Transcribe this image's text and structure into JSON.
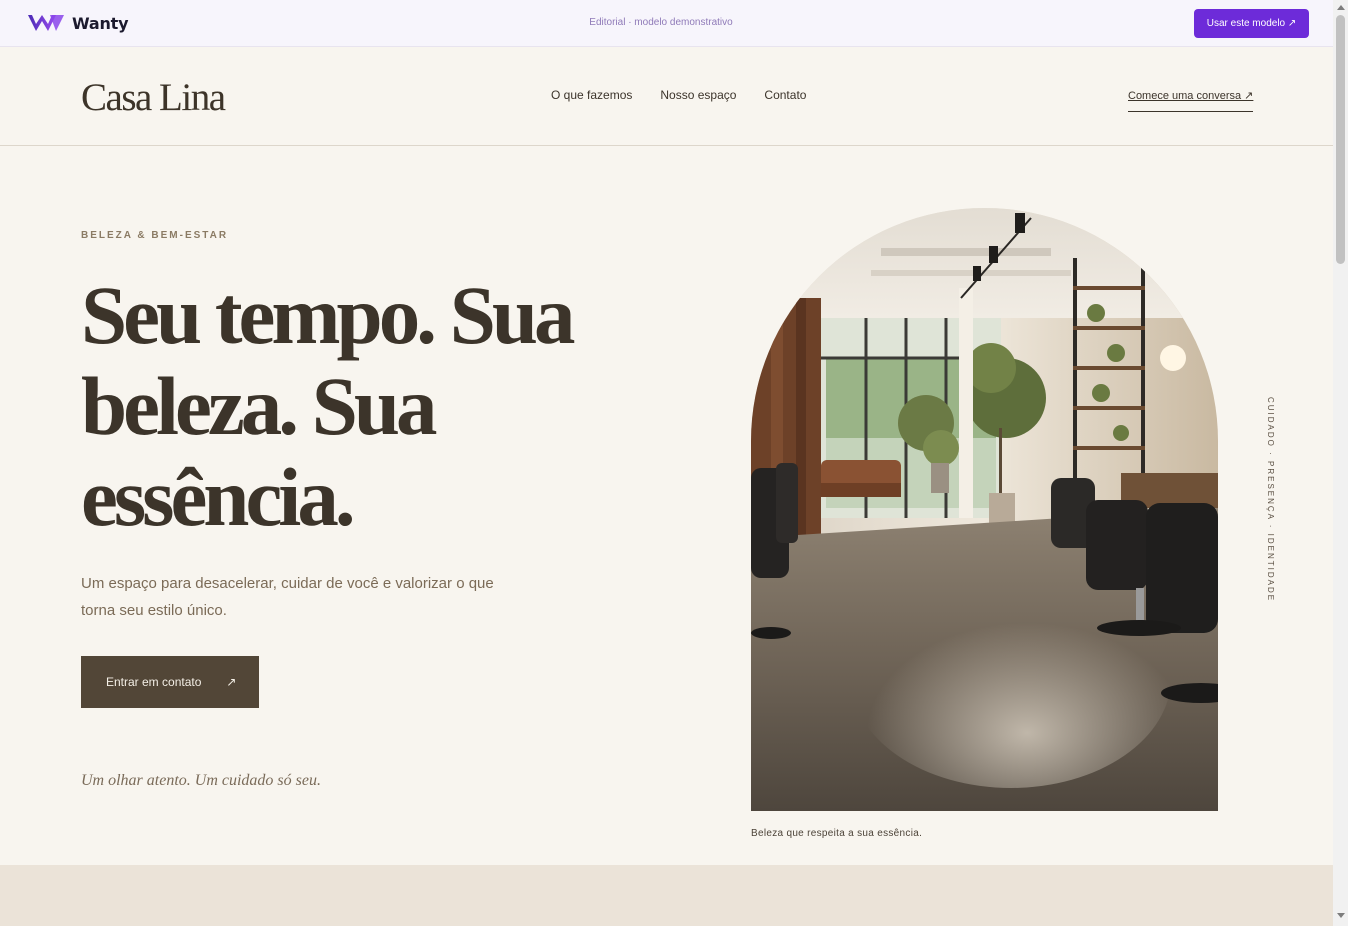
{
  "topbar": {
    "brand_name": "Wanty",
    "center_text": "Editorial · modelo demonstrativo",
    "use_button": "Usar este modelo ↗"
  },
  "header": {
    "logo": "Casa Lina",
    "nav": [
      "O que fazemos",
      "Nosso espaço",
      "Contato"
    ],
    "cta": "Comece uma conversa ↗"
  },
  "hero": {
    "eyebrow": "BELEZA & BEM-ESTAR",
    "headline_lines": [
      "Seu tempo. Sua",
      "beleza. Sua",
      "essência."
    ],
    "lead": "Um espaço para desacelerar, cuidar de você e valorizar o que torna seu estilo único.",
    "button_label": "Entrar em contato",
    "button_arrow": "↗",
    "tagline": "Um olhar atento. Um cuidado só seu.",
    "image_caption": "Beleza que respeita a sua essência.",
    "vertical_text": "CUIDADO · PRESENÇA · IDENTIDADE"
  },
  "icons": {
    "brand_logo": "wanty-w-logo-icon",
    "arrow": "arrow-up-right-icon"
  },
  "colors": {
    "accent": "#6d2bd9",
    "background": "#f8f5ef",
    "text_dark": "#3c342a",
    "button_dark": "#524637",
    "band": "#ebe3d8"
  }
}
